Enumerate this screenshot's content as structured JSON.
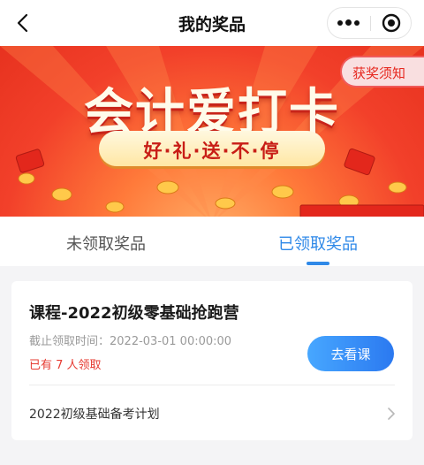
{
  "navbar": {
    "title": "我的奖品"
  },
  "banner": {
    "rules_label": "获奖须知",
    "title": "会计爱打卡",
    "slogan": "好·礼·送·不·停"
  },
  "tabs": [
    {
      "label": "未领取奖品",
      "active": false
    },
    {
      "label": "已领取奖品",
      "active": true
    }
  ],
  "card": {
    "course_title": "课程-2022初级零基础抢跑营",
    "deadline": "截止领取时间：2022-03-01 00:00:00",
    "claimed_count": "已有 7 人领取",
    "view_button": "去看课",
    "plan_label": "2022初级基础备考计划"
  },
  "colors": {
    "accent_blue": "#2f89e8",
    "count_red": "#e63b32",
    "banner_red": "#e7321f"
  },
  "icons": [
    "back-arrow-icon",
    "more-dots-icon",
    "target-icon",
    "chevron-right-icon"
  ]
}
